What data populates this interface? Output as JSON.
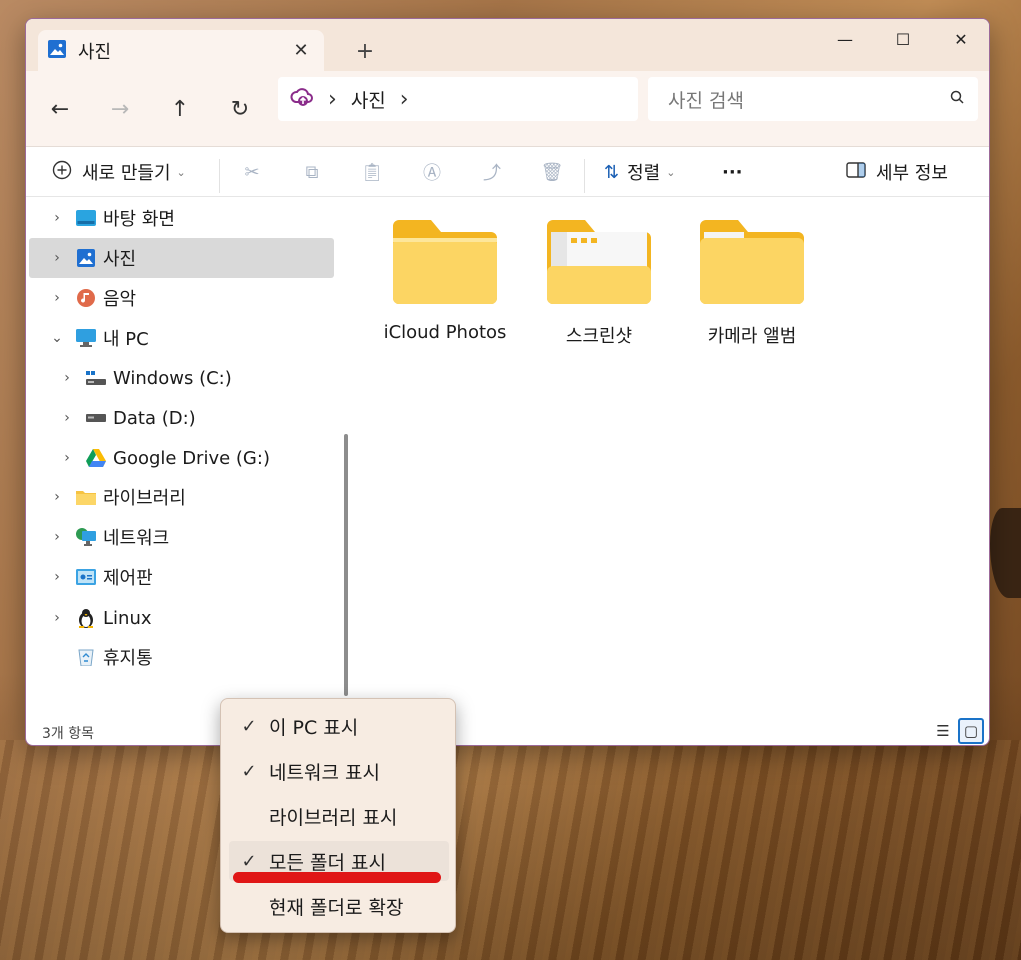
{
  "window": {
    "tab_title": "사진",
    "controls": {
      "minimize": "—",
      "maximize": "☐",
      "close": "✕"
    }
  },
  "address": {
    "path": "사진",
    "search_placeholder": "사진 검색"
  },
  "toolbar": {
    "new_label": "새로 만들기",
    "sort_label": "정렬",
    "more_label": "···",
    "details_label": "세부 정보"
  },
  "sidebar": {
    "items": [
      {
        "label": "바탕 화면",
        "icon": "desktop-icon",
        "expandable": true,
        "indent": 0
      },
      {
        "label": "사진",
        "icon": "pictures-icon",
        "expandable": true,
        "indent": 0,
        "selected": true
      },
      {
        "label": "음악",
        "icon": "music-icon",
        "expandable": true,
        "indent": 0
      },
      {
        "label": "내 PC",
        "icon": "pc-icon",
        "expandable": true,
        "expanded": true,
        "indent": 0
      },
      {
        "label": "Windows (C:)",
        "icon": "drive-c-icon",
        "expandable": true,
        "indent": 1
      },
      {
        "label": "Data (D:)",
        "icon": "drive-icon",
        "expandable": true,
        "indent": 1
      },
      {
        "label": "Google Drive (G:)",
        "icon": "google-drive-icon",
        "expandable": true,
        "indent": 1
      },
      {
        "label": "라이브러리",
        "icon": "library-icon",
        "expandable": true,
        "indent": 0
      },
      {
        "label": "네트워크",
        "icon": "network-icon",
        "expandable": true,
        "indent": 0
      },
      {
        "label": "제어판",
        "icon": "control-panel-icon",
        "expandable": true,
        "indent": 0
      },
      {
        "label": "Linux",
        "icon": "linux-icon",
        "expandable": true,
        "indent": 0
      },
      {
        "label": "휴지통",
        "icon": "recycle-bin-icon",
        "expandable": false,
        "indent": 0
      }
    ]
  },
  "content": {
    "folders": [
      {
        "name": "iCloud Photos"
      },
      {
        "name": "스크린샷"
      },
      {
        "name": "카메라 앨범"
      }
    ]
  },
  "status": {
    "item_count": "3개 항목"
  },
  "context_menu": {
    "items": [
      {
        "label": "이 PC 표시",
        "checked": true
      },
      {
        "label": "네트워크 표시",
        "checked": true
      },
      {
        "label": "라이브러리 표시",
        "checked": false
      },
      {
        "label": "모든 폴더 표시",
        "checked": true,
        "highlighted": true
      },
      {
        "label": "현재 폴더로 확장",
        "checked": false
      }
    ],
    "check_mark": "✓"
  },
  "colors": {
    "accent": "#1a73c8",
    "folder": "#f9c93c",
    "annotation": "#e01616"
  }
}
